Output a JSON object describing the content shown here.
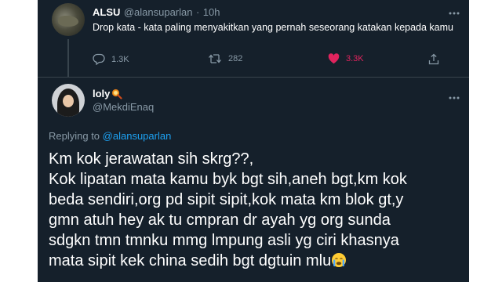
{
  "tweet": {
    "author_name": "ALSU",
    "author_handle": "@alansuparlan",
    "separator": "·",
    "time": "10h",
    "text": "Drop kata - kata paling menyakitkan yang pernah seseorang katakan kepada kamu",
    "replies": "1.3K",
    "retweets": "282",
    "likes": "3.3K",
    "icons": [
      "reply-icon",
      "retweet-icon",
      "heart-icon",
      "share-icon",
      "more-icon"
    ],
    "like_color": "#e0245e"
  },
  "reply": {
    "author_name": "loly",
    "author_handle": "@MekdiEnaq",
    "replying_prefix": "Replying to",
    "replying_to": "@alansuparlan",
    "lines": [
      "Km kok jerawatan sih skrg??,",
      "Kok lipatan mata kamu byk bgt sih,aneh bgt,km kok",
      "beda sendiri,org pd sipit sipit,kok mata km blok gt,y",
      "gmn atuh hey ak tu cmpran dr ayah yg org sunda",
      "sdgkn tmn tmnku mmg lmpung asli yg ciri khasnya",
      "mata sipit kek china sedih bgt dgtuin mlu"
    ],
    "icons": [
      "magnifier-emoji-icon",
      "crying-emoji-icon",
      "more-icon"
    ]
  },
  "colors": {
    "background": "#15202b",
    "text": "#ffffff",
    "muted": "#8899a6",
    "link": "#1da1f2",
    "divider": "#38444d"
  }
}
